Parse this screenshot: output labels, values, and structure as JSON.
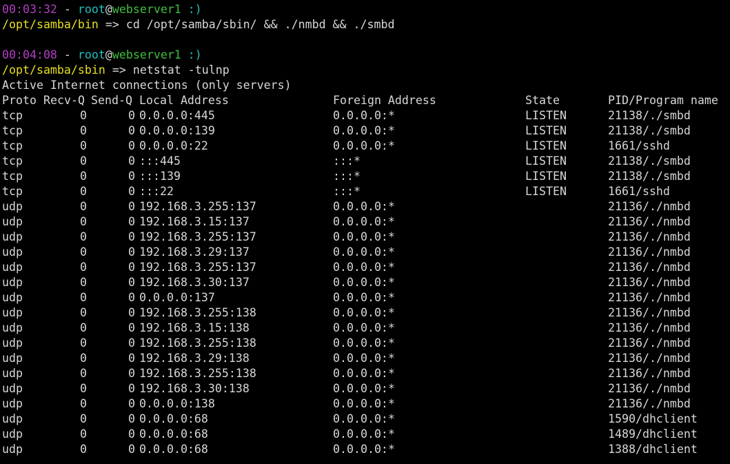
{
  "colors": {
    "background": "#000000",
    "text": "#d8d8d8",
    "time": "#b040c0",
    "user": "#20c0c0",
    "host": "#40c040",
    "path": "#e8e020"
  },
  "prompts": [
    {
      "time": "00:03:32",
      "dash": " - ",
      "user": "root",
      "at": "@",
      "host": "webserver1",
      "suffix": " :)",
      "path": "/opt/samba/bin",
      "arrow": " => ",
      "command": "cd /opt/samba/sbin/ && ./nmbd && ./smbd"
    },
    {
      "time": "00:04:08",
      "dash": " - ",
      "user": "root",
      "at": "@",
      "host": "webserver1",
      "suffix": " :)",
      "path": "/opt/samba/sbin",
      "arrow": " => ",
      "command": "netstat -tulnp"
    }
  ],
  "netstat": {
    "title": "Active Internet connections (only servers)",
    "headers": {
      "proto": "Proto",
      "recv": "Recv-Q",
      "send": "Send-Q",
      "local": "Local Address",
      "foreign": "Foreign Address",
      "state": "State",
      "pid": "PID/Program name"
    },
    "rows": [
      {
        "proto": "tcp",
        "recv": "0",
        "send": "0",
        "local": "0.0.0.0:445",
        "foreign": "0.0.0.0:*",
        "state": "LISTEN",
        "pid": "21138/./smbd"
      },
      {
        "proto": "tcp",
        "recv": "0",
        "send": "0",
        "local": "0.0.0.0:139",
        "foreign": "0.0.0.0:*",
        "state": "LISTEN",
        "pid": "21138/./smbd"
      },
      {
        "proto": "tcp",
        "recv": "0",
        "send": "0",
        "local": "0.0.0.0:22",
        "foreign": "0.0.0.0:*",
        "state": "LISTEN",
        "pid": "1661/sshd"
      },
      {
        "proto": "tcp",
        "recv": "0",
        "send": "0",
        "local": ":::445",
        "foreign": ":::*",
        "state": "LISTEN",
        "pid": "21138/./smbd"
      },
      {
        "proto": "tcp",
        "recv": "0",
        "send": "0",
        "local": ":::139",
        "foreign": ":::*",
        "state": "LISTEN",
        "pid": "21138/./smbd"
      },
      {
        "proto": "tcp",
        "recv": "0",
        "send": "0",
        "local": ":::22",
        "foreign": ":::*",
        "state": "LISTEN",
        "pid": "1661/sshd"
      },
      {
        "proto": "udp",
        "recv": "0",
        "send": "0",
        "local": "192.168.3.255:137",
        "foreign": "0.0.0.0:*",
        "state": "",
        "pid": "21136/./nmbd"
      },
      {
        "proto": "udp",
        "recv": "0",
        "send": "0",
        "local": "192.168.3.15:137",
        "foreign": "0.0.0.0:*",
        "state": "",
        "pid": "21136/./nmbd"
      },
      {
        "proto": "udp",
        "recv": "0",
        "send": "0",
        "local": "192.168.3.255:137",
        "foreign": "0.0.0.0:*",
        "state": "",
        "pid": "21136/./nmbd"
      },
      {
        "proto": "udp",
        "recv": "0",
        "send": "0",
        "local": "192.168.3.29:137",
        "foreign": "0.0.0.0:*",
        "state": "",
        "pid": "21136/./nmbd"
      },
      {
        "proto": "udp",
        "recv": "0",
        "send": "0",
        "local": "192.168.3.255:137",
        "foreign": "0.0.0.0:*",
        "state": "",
        "pid": "21136/./nmbd"
      },
      {
        "proto": "udp",
        "recv": "0",
        "send": "0",
        "local": "192.168.3.30:137",
        "foreign": "0.0.0.0:*",
        "state": "",
        "pid": "21136/./nmbd"
      },
      {
        "proto": "udp",
        "recv": "0",
        "send": "0",
        "local": "0.0.0.0:137",
        "foreign": "0.0.0.0:*",
        "state": "",
        "pid": "21136/./nmbd"
      },
      {
        "proto": "udp",
        "recv": "0",
        "send": "0",
        "local": "192.168.3.255:138",
        "foreign": "0.0.0.0:*",
        "state": "",
        "pid": "21136/./nmbd"
      },
      {
        "proto": "udp",
        "recv": "0",
        "send": "0",
        "local": "192.168.3.15:138",
        "foreign": "0.0.0.0:*",
        "state": "",
        "pid": "21136/./nmbd"
      },
      {
        "proto": "udp",
        "recv": "0",
        "send": "0",
        "local": "192.168.3.255:138",
        "foreign": "0.0.0.0:*",
        "state": "",
        "pid": "21136/./nmbd"
      },
      {
        "proto": "udp",
        "recv": "0",
        "send": "0",
        "local": "192.168.3.29:138",
        "foreign": "0.0.0.0:*",
        "state": "",
        "pid": "21136/./nmbd"
      },
      {
        "proto": "udp",
        "recv": "0",
        "send": "0",
        "local": "192.168.3.255:138",
        "foreign": "0.0.0.0:*",
        "state": "",
        "pid": "21136/./nmbd"
      },
      {
        "proto": "udp",
        "recv": "0",
        "send": "0",
        "local": "192.168.3.30:138",
        "foreign": "0.0.0.0:*",
        "state": "",
        "pid": "21136/./nmbd"
      },
      {
        "proto": "udp",
        "recv": "0",
        "send": "0",
        "local": "0.0.0.0:138",
        "foreign": "0.0.0.0:*",
        "state": "",
        "pid": "21136/./nmbd"
      },
      {
        "proto": "udp",
        "recv": "0",
        "send": "0",
        "local": "0.0.0.0:68",
        "foreign": "0.0.0.0:*",
        "state": "",
        "pid": "1590/dhclient"
      },
      {
        "proto": "udp",
        "recv": "0",
        "send": "0",
        "local": "0.0.0.0:68",
        "foreign": "0.0.0.0:*",
        "state": "",
        "pid": "1489/dhclient"
      },
      {
        "proto": "udp",
        "recv": "0",
        "send": "0",
        "local": "0.0.0.0:68",
        "foreign": "0.0.0.0:*",
        "state": "",
        "pid": "1388/dhclient"
      }
    ]
  }
}
